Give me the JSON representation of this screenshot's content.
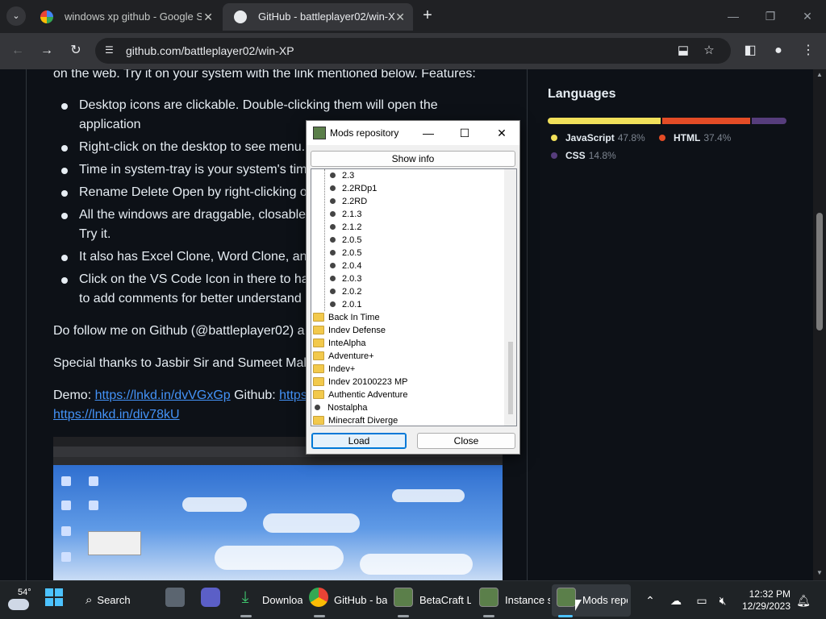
{
  "browser": {
    "tabs": [
      {
        "title": "windows xp github - Google Se",
        "active": false,
        "icon": "google-icon"
      },
      {
        "title": "GitHub - battleplayer02/win-XP",
        "active": true,
        "icon": "github-icon"
      }
    ],
    "url": "github.com/battleplayer02/win-XP"
  },
  "readme": {
    "intro_line": "on the web. Try it on your system with the link mentioned below. Features:",
    "bullets": [
      [
        "Desktop icons are clickable. Double-clicking them will open the",
        "application"
      ],
      [
        "Right-click on the desktop to see menu."
      ],
      [
        "Time in system-tray is your system's tim"
      ],
      [
        "Rename Delete Open by right-clicking o"
      ],
      [
        "All the windows are draggable, closable,",
        "Try it."
      ],
      [
        "It also has Excel Clone, Word Clone, and"
      ],
      [
        "Click on the VS Code Icon in there to ha",
        "to add comments for better understand"
      ]
    ],
    "follow_line": "Do follow me on Github (@battleplayer02) a",
    "thanks_line": "Special thanks to Jasbir Sir and Sumeet Malik",
    "demo_label": "Demo: ",
    "demo_link": "https://lnkd.in/dvVGxGp",
    "github_label": " Github: ",
    "github_link": "https:",
    "second_link": "https://lnkd.in/div78kU"
  },
  "languages": {
    "title": "Languages",
    "items": [
      {
        "name": "JavaScript",
        "percent": "47.8%",
        "value": 47.8,
        "color": "#f1e05a"
      },
      {
        "name": "HTML",
        "percent": "37.4%",
        "value": 37.4,
        "color": "#e34c26"
      },
      {
        "name": "CSS",
        "percent": "14.8%",
        "value": 14.8,
        "color": "#563d7c"
      }
    ]
  },
  "dialog": {
    "title": "Mods repository",
    "show_info": "Show info",
    "load": "Load",
    "close": "Close",
    "versions": [
      "2.3",
      "2.2RDp1",
      "2.2RD",
      "2.1.3",
      "2.1.2",
      "2.0.5",
      "2.0.5",
      "2.0.4",
      "2.0.3",
      "2.0.2",
      "2.0.1"
    ],
    "folders": [
      {
        "label": "Back In Time",
        "kind": "folder"
      },
      {
        "label": "Indev Defense",
        "kind": "folder"
      },
      {
        "label": "InteAlpha",
        "kind": "folder"
      },
      {
        "label": "Adventure+",
        "kind": "folder"
      },
      {
        "label": "Indev+",
        "kind": "folder"
      },
      {
        "label": "Indev 20100223 MP",
        "kind": "folder"
      },
      {
        "label": "Authentic Adventure",
        "kind": "folder"
      },
      {
        "label": "Nostalpha",
        "kind": "leaf"
      },
      {
        "label": "Minecraft Diverge",
        "kind": "folder"
      }
    ]
  },
  "taskbar": {
    "temperature": "54°",
    "search": "Search",
    "apps": [
      {
        "label": "Downloa",
        "icon": "download-icon"
      },
      {
        "label": "GitHub - ba",
        "icon": "chrome-icon"
      },
      {
        "label": "BetaCraft La",
        "icon": "betacraft-icon"
      },
      {
        "label": "Instance se",
        "icon": "betacraft-icon"
      },
      {
        "label": "Mods repo",
        "icon": "betacraft-icon"
      }
    ],
    "time": "12:32 PM",
    "date": "12/29/2023"
  }
}
